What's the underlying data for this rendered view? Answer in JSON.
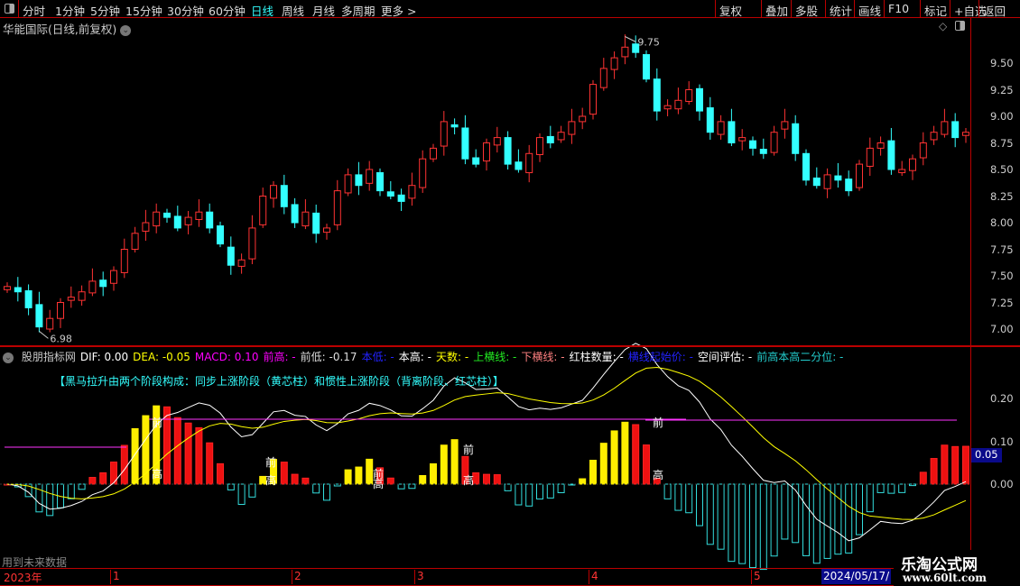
{
  "toolbar": {
    "tabs": [
      "分时",
      "1分钟",
      "5分钟",
      "15分钟",
      "30分钟",
      "60分钟",
      "日线",
      "周线",
      "月线",
      "多周期",
      "更多 >"
    ],
    "active": "日线",
    "right_buttons": [
      "复权",
      "叠加",
      "多股",
      "统计",
      "画线",
      "F10",
      "标记",
      "+自选",
      "返回"
    ]
  },
  "title": "华能国际(日线,前复权)",
  "price_axis": [
    "9.50",
    "9.25",
    "9.00",
    "8.75",
    "8.50",
    "8.25",
    "8.00",
    "7.75",
    "7.50",
    "7.25",
    "7.00"
  ],
  "price_annotations": {
    "high": "9.75",
    "low": "6.98"
  },
  "indicator": {
    "name": "股朋指标网",
    "items": [
      {
        "text": "DIF: 0.00",
        "color": "#ffffff"
      },
      {
        "text": "DEA: -0.05",
        "color": "#ffff00"
      },
      {
        "text": "MACD: 0.10",
        "color": "#ff00ff"
      },
      {
        "text": "前高: -",
        "color": "#ff00ff"
      },
      {
        "text": "前低: -0.17",
        "color": "#dddddd"
      },
      {
        "text": "本低: -",
        "color": "#2222ff"
      },
      {
        "text": "本高: -",
        "color": "#ffffff"
      },
      {
        "text": "天数: -",
        "color": "#ffff00"
      },
      {
        "text": "上横线: -",
        "color": "#22ee22"
      },
      {
        "text": "下横线: -",
        "color": "#ff8080"
      },
      {
        "text": "红柱数量: -",
        "color": "#ffffff"
      },
      {
        "text": "横线起始价: -",
        "color": "#2222ff"
      },
      {
        "text": "空间评估: -",
        "color": "#ffffff"
      },
      {
        "text": "前高本高二分位: -",
        "color": "#22cccc"
      }
    ],
    "subtitle": "【黑马拉升由两个阶段构成：同步上涨阶段（黄芯柱）和惯性上涨阶段（背离阶段、红芯柱）】",
    "axis": [
      "0.20",
      "0.10",
      "0.00"
    ],
    "current": "0.05",
    "marks": {
      "front": "前",
      "high": "高"
    }
  },
  "future_note": "用到未来数据",
  "date_axis": {
    "labels": [
      "2023年",
      "1",
      "2",
      "3",
      "4",
      "5"
    ],
    "current": "2024/05/17/"
  },
  "watermark": {
    "name": "乐淘公式网",
    "url": "www.60lt.com"
  },
  "chart_data": {
    "type": "candlestick",
    "ylim": [
      6.9,
      9.8
    ],
    "close": [
      7.4,
      7.35,
      7.2,
      7.02,
      7.1,
      7.25,
      7.3,
      7.35,
      7.45,
      7.4,
      7.55,
      7.75,
      7.9,
      8.0,
      8.1,
      8.05,
      7.95,
      8.05,
      8.1,
      7.95,
      7.8,
      7.6,
      7.65,
      7.95,
      8.25,
      8.35,
      8.15,
      8.0,
      8.1,
      7.9,
      7.95,
      8.3,
      8.45,
      8.35,
      8.5,
      8.3,
      8.25,
      8.2,
      8.35,
      8.6,
      8.7,
      8.95,
      8.9,
      8.6,
      8.55,
      8.75,
      8.8,
      8.55,
      8.5,
      8.65,
      8.8,
      8.75,
      8.85,
      8.95,
      9.0,
      9.3,
      9.45,
      9.55,
      9.65,
      9.6,
      9.35,
      9.05,
      9.1,
      9.15,
      9.25,
      9.05,
      8.85,
      8.95,
      8.75,
      8.8,
      8.7,
      8.65,
      8.85,
      8.95,
      8.65,
      8.4,
      8.35,
      8.45,
      8.4,
      8.3,
      8.55,
      8.7,
      8.75,
      8.5,
      8.5,
      8.6,
      8.75,
      8.85,
      8.95,
      8.8,
      8.85
    ]
  }
}
